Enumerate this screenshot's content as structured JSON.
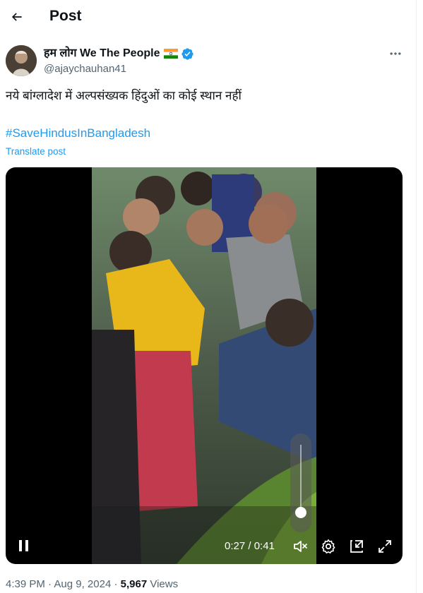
{
  "header": {
    "title": "Post",
    "back_icon": "arrow-left-icon"
  },
  "author": {
    "display_name": "हम लोग We The People",
    "handle": "@ajaychauhan41",
    "flag_icon": "india-flag-icon",
    "verified": true,
    "verified_color": "#1d9bf0"
  },
  "post": {
    "text": "नये बांग्लादेश में अल्पसंख्यक हिंदुओं का कोई स्थान नहीं",
    "hashtag": "#SaveHindusInBangladesh",
    "translate_label": "Translate post",
    "link_color": "#1d9bf0"
  },
  "video": {
    "time": "0:27 / 0:41",
    "progress": 0.66,
    "volume": 0,
    "muted": true
  },
  "meta": {
    "time": "4:39 PM",
    "sep1": "·",
    "date": "Aug 9, 2024",
    "sep2": "·",
    "views_count": "5,967",
    "views_label": "Views"
  }
}
